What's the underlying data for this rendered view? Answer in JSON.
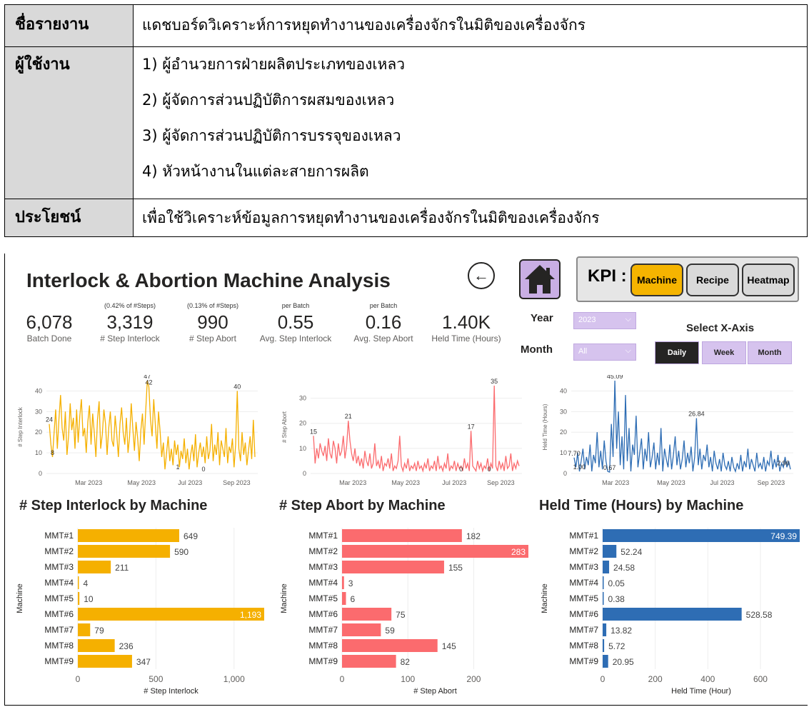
{
  "info_table": {
    "rows": [
      {
        "label": "ชื่อรายงาน",
        "values": [
          "แดชบอร์ดวิเคราะห์การหยุดทำงานของเครื่องจักรในมิติของเครื่องจักร"
        ]
      },
      {
        "label": "ผู้ใช้งาน",
        "values": [
          "1) ผู้อำนวยการฝ่ายผลิตประเภทของเหลว",
          "2) ผู้จัดการส่วนปฏิบัติการผสมของเหลว",
          "3) ผู้จัดการส่วนปฏิบัติการบรรจุของเหลว",
          "4) หัวหน้างานในแต่ละสายการผลิต"
        ]
      },
      {
        "label": "ประโยชน์",
        "values": [
          "เพื่อใช้วิเคราะห์ข้อมูลการหยุดทำงานของเครื่องจักรในมิติของเครื่องจักร"
        ]
      }
    ]
  },
  "dashboard": {
    "title": "Interlock & Abortion Machine Analysis",
    "back_icon": "←",
    "kpi_label": "KPI :",
    "kpi_tabs": [
      "Machine",
      "Recipe",
      "Heatmap"
    ],
    "kpis": [
      {
        "note": "",
        "value": "6,078",
        "caption": "Batch Done"
      },
      {
        "note": "(0.42% of #Steps)",
        "value": "3,319",
        "caption": "# Step Interlock"
      },
      {
        "note": "(0.13% of #Steps)",
        "value": "990",
        "caption": "# Step Abort"
      },
      {
        "note": "per Batch",
        "value": "0.55",
        "caption": "Avg. Step Interlock"
      },
      {
        "note": "per Batch",
        "value": "0.16",
        "caption": "Avg. Step Abort"
      },
      {
        "note": "",
        "value": "1.40K",
        "caption": "Held Time (Hours)"
      }
    ],
    "filters": {
      "year_label": "Year",
      "year_value": "2023",
      "month_label": "Month",
      "month_value": "All",
      "select_x_label": "Select X-Axis",
      "x_options": [
        "Daily",
        "Week",
        "Month"
      ],
      "x_selected": "Daily"
    },
    "colors": {
      "interlock": "#f5b000",
      "abort": "#fb6b6e",
      "held": "#2e6db4"
    }
  },
  "chart_data": [
    {
      "type": "line",
      "series": [
        {
          "name": "# Step Interlock"
        }
      ],
      "ylabel": "# Step Interlock",
      "yticks": [
        0,
        10,
        20,
        30,
        40
      ],
      "ylim": [
        0,
        45
      ],
      "xticks": [
        "Mar 2023",
        "May 2023",
        "Jul 2023",
        "Sep 2023"
      ],
      "annotations": [
        "24",
        "47",
        "42",
        "40",
        "1",
        "0",
        "8"
      ],
      "values": [
        24,
        14,
        8,
        20,
        31,
        12,
        26,
        38,
        22,
        16,
        30,
        9,
        18,
        34,
        21,
        27,
        12,
        31,
        15,
        28,
        36,
        18,
        22,
        10,
        25,
        33,
        14,
        29,
        20,
        8,
        26,
        35,
        12,
        19,
        31,
        24,
        9,
        22,
        30,
        16,
        13,
        28,
        19,
        8,
        24,
        32,
        20,
        14,
        27,
        10,
        18,
        34,
        22,
        11,
        25,
        17,
        6,
        21,
        29,
        14,
        30,
        47,
        42,
        26,
        18,
        36,
        24,
        12,
        30,
        20,
        8,
        15,
        2,
        10,
        18,
        6,
        12,
        4,
        16,
        9,
        14,
        3,
        11,
        7,
        17,
        5,
        12,
        2,
        9,
        14,
        6,
        19,
        3,
        10,
        15,
        8,
        13,
        5,
        18,
        7,
        11,
        24,
        6,
        14,
        9,
        20,
        4,
        16,
        12,
        8,
        22,
        5,
        13,
        10,
        17,
        3,
        14,
        40,
        12,
        6,
        20,
        9,
        15,
        4,
        11,
        18,
        7,
        26,
        8
      ]
    },
    {
      "type": "line",
      "series": [
        {
          "name": "# Step Abort"
        }
      ],
      "ylabel": "# Step Abort",
      "yticks": [
        0,
        10,
        20,
        30
      ],
      "ylim": [
        0,
        37
      ],
      "xticks": [
        "Mar 2023",
        "May 2023",
        "Jul 2023",
        "Sep 2023"
      ],
      "annotations": [
        "15",
        "21",
        "17",
        "35",
        "0",
        "0"
      ],
      "values": [
        15,
        4,
        10,
        6,
        12,
        9,
        7,
        11,
        5,
        14,
        8,
        6,
        13,
        10,
        4,
        12,
        7,
        9,
        15,
        6,
        11,
        21,
        13,
        8,
        5,
        10,
        4,
        7,
        3,
        6,
        2,
        9,
        5,
        3,
        8,
        2,
        4,
        12,
        3,
        5,
        2,
        7,
        1,
        4,
        3,
        6,
        2,
        8,
        1,
        3,
        2,
        5,
        15,
        3,
        1,
        4,
        2,
        6,
        1,
        3,
        2,
        4,
        1,
        5,
        2,
        3,
        1,
        4,
        2,
        6,
        1,
        3,
        2,
        5,
        1,
        7,
        2,
        3,
        1,
        4,
        2,
        8,
        1,
        3,
        2,
        5,
        1,
        4,
        2,
        3,
        1,
        6,
        2,
        4,
        1,
        17,
        3,
        2,
        1,
        5,
        2,
        4,
        1,
        3,
        2,
        6,
        1,
        4,
        2,
        35,
        3,
        1,
        5,
        2,
        4,
        1,
        7,
        2,
        3,
        8,
        1,
        4,
        2,
        5,
        3
      ]
    },
    {
      "type": "line",
      "series": [
        {
          "name": "Held Time (Hours)"
        }
      ],
      "ylabel": "Held Time (Hours)",
      "yticks": [
        0,
        10,
        20,
        30,
        40
      ],
      "ylim": [
        0,
        45
      ],
      "xticks": [
        "Mar 2023",
        "May 2023",
        "Jul 2023",
        "Sep 2023"
      ],
      "annotations": [
        "7.70",
        "0.67",
        "45.09",
        "26.84",
        "1.00",
        "2.96"
      ],
      "values": [
        7.7,
        3,
        10,
        1,
        6,
        12,
        2,
        8,
        4,
        14,
        1,
        9,
        5,
        20,
        3,
        11,
        2,
        16,
        6,
        1,
        0.67,
        24,
        8,
        45.09,
        12,
        30,
        4,
        18,
        2,
        38,
        6,
        22,
        1,
        14,
        9,
        28,
        3,
        10,
        17,
        2,
        12,
        6,
        20,
        3,
        8,
        15,
        2,
        10,
        4,
        22,
        1,
        12,
        7,
        3,
        14,
        2,
        9,
        18,
        4,
        11,
        2,
        7,
        16,
        3,
        10,
        5,
        13,
        1,
        8,
        26.84,
        4,
        12,
        2,
        9,
        6,
        14,
        3,
        8,
        1,
        11,
        5,
        2,
        7,
        1,
        10,
        4,
        2,
        6,
        1,
        8,
        3,
        1.0,
        5,
        2,
        9,
        1,
        6,
        3,
        12,
        2,
        7,
        4,
        1,
        10,
        3,
        5,
        2,
        8,
        1,
        6,
        4,
        11,
        2,
        7,
        3,
        9,
        1,
        5,
        2.96,
        8,
        3,
        6,
        2
      ]
    },
    {
      "type": "bar",
      "title": "# Step Interlock by Machine",
      "categories": [
        "MMT#1",
        "MMT#2",
        "MMT#3",
        "MMT#4",
        "MMT#5",
        "MMT#6",
        "MMT#7",
        "MMT#8",
        "MMT#9"
      ],
      "values": [
        649,
        590,
        211,
        4,
        10,
        1193,
        79,
        236,
        347
      ],
      "labels": [
        "649",
        "590",
        "211",
        "4",
        "10",
        "1,193",
        "79",
        "236",
        "347"
      ],
      "xlabel": "# Step Interlock",
      "ylabel": "Machine",
      "xticks": [
        "0",
        "500",
        "1,000"
      ],
      "xlim": [
        0,
        1193
      ]
    },
    {
      "type": "bar",
      "title": "# Step Abort by Machine",
      "categories": [
        "MMT#1",
        "MMT#2",
        "MMT#3",
        "MMT#4",
        "MMT#5",
        "MMT#6",
        "MMT#7",
        "MMT#8",
        "MMT#9"
      ],
      "values": [
        182,
        283,
        155,
        3,
        6,
        75,
        59,
        145,
        82
      ],
      "labels": [
        "182",
        "283",
        "155",
        "3",
        "6",
        "75",
        "59",
        "145",
        "82"
      ],
      "xlabel": "# Step Abort",
      "ylabel": "Machine",
      "xticks": [
        "0",
        "100",
        "200"
      ],
      "xlim": [
        0,
        283
      ]
    },
    {
      "type": "bar",
      "title": "Held Time (Hours) by Machine",
      "categories": [
        "MMT#1",
        "MMT#2",
        "MMT#3",
        "MMT#4",
        "MMT#5",
        "MMT#6",
        "MMT#7",
        "MMT#8",
        "MMT#9"
      ],
      "values": [
        749.39,
        52.24,
        24.58,
        0.05,
        0.38,
        528.58,
        13.82,
        5.72,
        20.95
      ],
      "labels": [
        "749.39",
        "52.24",
        "24.58",
        "0.05",
        "0.38",
        "528.58",
        "13.82",
        "5.72",
        "20.95"
      ],
      "xlabel": "Held Time (Hour)",
      "ylabel": "Machine",
      "xticks": [
        "0",
        "200",
        "400",
        "600"
      ],
      "xlim": [
        0,
        749.39
      ]
    }
  ]
}
